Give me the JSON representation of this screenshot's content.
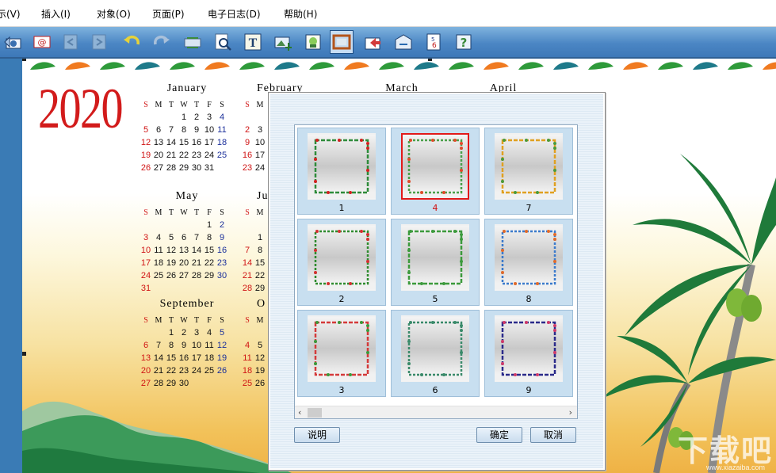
{
  "menu": {
    "items": [
      {
        "label": "示(V)"
      },
      {
        "label": "插入(I)"
      },
      {
        "label": "对象(O)"
      },
      {
        "label": "页面(P)"
      },
      {
        "label": "电子日志(D)"
      },
      {
        "label": "帮助(H)"
      }
    ]
  },
  "toolbar": {
    "buttons": [
      {
        "icon": "camera-icon"
      },
      {
        "icon": "email-icon"
      },
      {
        "icon": "back-page-icon"
      },
      {
        "icon": "forward-page-icon"
      },
      {
        "icon": "undo-icon"
      },
      {
        "icon": "redo-icon"
      },
      {
        "icon": "refresh-icon"
      },
      {
        "icon": "zoom-page-icon"
      },
      {
        "icon": "text-icon"
      },
      {
        "icon": "image-insert-icon"
      },
      {
        "icon": "photo-icon"
      },
      {
        "icon": "frame-icon"
      },
      {
        "icon": "import-icon"
      },
      {
        "icon": "export-icon"
      },
      {
        "icon": "calendar-icon"
      },
      {
        "icon": "help-icon"
      }
    ]
  },
  "calendar": {
    "year": "2020",
    "weekdays": [
      "S",
      "M",
      "T",
      "W",
      "T",
      "F",
      "S"
    ],
    "months": [
      {
        "name": "January",
        "weeks": [
          [
            "",
            "",
            "",
            "1",
            "2",
            "3",
            "4"
          ],
          [
            "5",
            "6",
            "7",
            "8",
            "9",
            "10",
            "11"
          ],
          [
            "12",
            "13",
            "14",
            "15",
            "16",
            "17",
            "18"
          ],
          [
            "19",
            "20",
            "21",
            "22",
            "23",
            "24",
            "25"
          ],
          [
            "26",
            "27",
            "28",
            "29",
            "30",
            "31",
            ""
          ]
        ]
      },
      {
        "name": "May",
        "weeks": [
          [
            "",
            "",
            "",
            "",
            "",
            "1",
            "2"
          ],
          [
            "3",
            "4",
            "5",
            "6",
            "7",
            "8",
            "9"
          ],
          [
            "10",
            "11",
            "12",
            "13",
            "14",
            "15",
            "16"
          ],
          [
            "17",
            "18",
            "19",
            "20",
            "21",
            "22",
            "23"
          ],
          [
            "24",
            "25",
            "26",
            "27",
            "28",
            "29",
            "30"
          ],
          [
            "31",
            "",
            "",
            "",
            "",
            "",
            ""
          ]
        ]
      },
      {
        "name": "September",
        "weeks": [
          [
            "",
            "",
            "1",
            "2",
            "3",
            "4",
            "5"
          ],
          [
            "6",
            "7",
            "8",
            "9",
            "10",
            "11",
            "12"
          ],
          [
            "13",
            "14",
            "15",
            "16",
            "17",
            "18",
            "19"
          ],
          [
            "20",
            "21",
            "22",
            "23",
            "24",
            "25",
            "26"
          ],
          [
            "27",
            "28",
            "29",
            "30",
            "",
            "",
            ""
          ]
        ]
      }
    ],
    "partial_months": [
      {
        "name": "February",
        "weeks": [
          [
            "S",
            "M"
          ],
          [
            "",
            ""
          ],
          [
            "2",
            "3"
          ],
          [
            "9",
            "10"
          ],
          [
            "16",
            "17"
          ],
          [
            "23",
            "24"
          ]
        ]
      },
      {
        "name": "June",
        "weeks": [
          [
            "S",
            "M"
          ],
          [
            "",
            ""
          ],
          [
            "",
            "1"
          ],
          [
            "7",
            "8"
          ],
          [
            "14",
            "15"
          ],
          [
            "21",
            "22"
          ],
          [
            "28",
            "29"
          ]
        ]
      },
      {
        "name": "O",
        "weeks": [
          [
            "S",
            "M"
          ],
          [
            "",
            ""
          ],
          [
            "4",
            "5"
          ],
          [
            "11",
            "12"
          ],
          [
            "18",
            "19"
          ],
          [
            "25",
            "26"
          ]
        ]
      }
    ],
    "hidden_months": [
      "March",
      "April"
    ]
  },
  "dialog": {
    "frames": [
      {
        "label": "1",
        "color": "#2e8b3a",
        "accent": "#d42020"
      },
      {
        "label": "4",
        "color": "#4aa04a",
        "accent": "#e04a2a",
        "selected": true
      },
      {
        "label": "7",
        "color": "#e0a020",
        "accent": "#4a9a3a"
      },
      {
        "label": "2",
        "color": "#2e8b2e",
        "accent": "#d43030"
      },
      {
        "label": "5",
        "color": "#3c9a3c",
        "accent": "#3c9a3c"
      },
      {
        "label": "8",
        "color": "#3a7acc",
        "accent": "#e06a2a"
      },
      {
        "label": "3",
        "color": "#d43a3a",
        "accent": "#3a9a3a"
      },
      {
        "label": "6",
        "color": "#3a8a6a",
        "accent": "#3a8a6a"
      },
      {
        "label": "9",
        "color": "#2a2a8a",
        "accent": "#d03a6a"
      }
    ],
    "buttons": {
      "help": "说明",
      "ok": "确定",
      "cancel": "取消"
    },
    "scroll": {
      "left": "‹",
      "right": "›"
    }
  },
  "watermark": {
    "text": "下载吧",
    "url": "www.xiazaiba.com"
  },
  "colors": {
    "accent": "#3a7bb5",
    "year": "#d21b1b",
    "selection": "#e21a1a"
  }
}
